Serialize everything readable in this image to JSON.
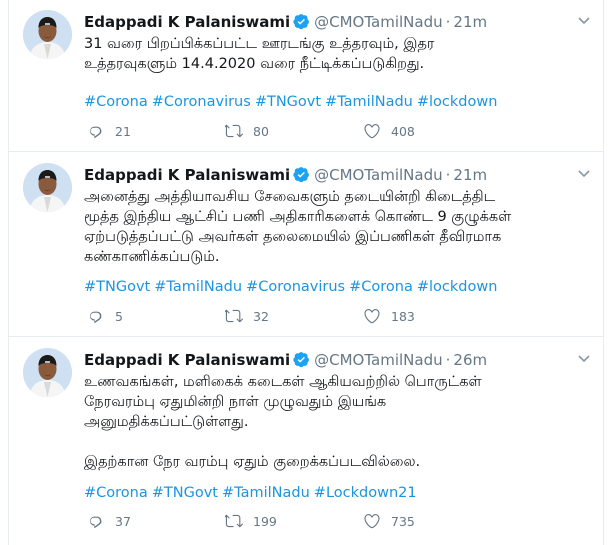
{
  "tweets": [
    {
      "name": "Edappadi K Palaniswami",
      "handle": "@CMOTamilNadu",
      "separator": "·",
      "time": "21m",
      "text": "31 வரை பிறப்பிக்கப்பட்ட ஊரடங்கு உத்தரவும், இதர\nஉத்தரவுகளும் 14.4.2020 வரை நீட்டிக்கப்படுகிறது.",
      "text2": "",
      "hashtags": [
        "#Corona",
        "#Coronavirus",
        "#TNGovt",
        "#TamilNadu",
        "#lockdown"
      ],
      "replies": "21",
      "retweets": "80",
      "likes": "408"
    },
    {
      "name": "Edappadi K Palaniswami",
      "handle": "@CMOTamilNadu",
      "separator": "·",
      "time": "21m",
      "text": "அனைத்து அத்தியாவசிய சேவைகளும் தடையின்றி கிடைத்திட\nமூத்த இந்திய ஆட்சிப் பணி அதிகாரிகளைக் கொண்ட 9 குழுக்கள்\nஏற்படுத்தப்பட்டு அவர்கள் தலைமையில் இப்பணிகள் தீவிரமாக\nகண்காணிக்கப்படும்.",
      "text2": "",
      "hashtags": [
        "#TNGovt",
        "#TamilNadu",
        "#Coronavirus",
        "#Corona",
        "#lockdown"
      ],
      "replies": "5",
      "retweets": "32",
      "likes": "183"
    },
    {
      "name": "Edappadi K Palaniswami",
      "handle": "@CMOTamilNadu",
      "separator": "·",
      "time": "26m",
      "text": "உணவகங்கள், மளிகைக் கடைகள் ஆகியவற்றில் பொருட்கள்\nநேரவரம்பு ஏதுமின்றி நாள் முழுவதும் இயங்க\nஅனுமதிக்கப்பட்டுள்ளது.",
      "text2": "இதற்கான நேர வரம்பு ஏதும் குறைக்கப்படவில்லை.",
      "hashtags": [
        "#Corona",
        "#TNGovt",
        "#TamilNadu",
        "#Lockdown21"
      ],
      "replies": "37",
      "retweets": "199",
      "likes": "735"
    }
  ],
  "icons": {
    "verified": "verified-badge-icon",
    "reply": "reply-icon",
    "retweet": "retweet-icon",
    "like": "heart-icon",
    "more": "chevron-down-icon"
  },
  "colors": {
    "accent": "#1b95e0",
    "text": "#14171a",
    "muted": "#657786",
    "border": "#e6ecf0"
  }
}
